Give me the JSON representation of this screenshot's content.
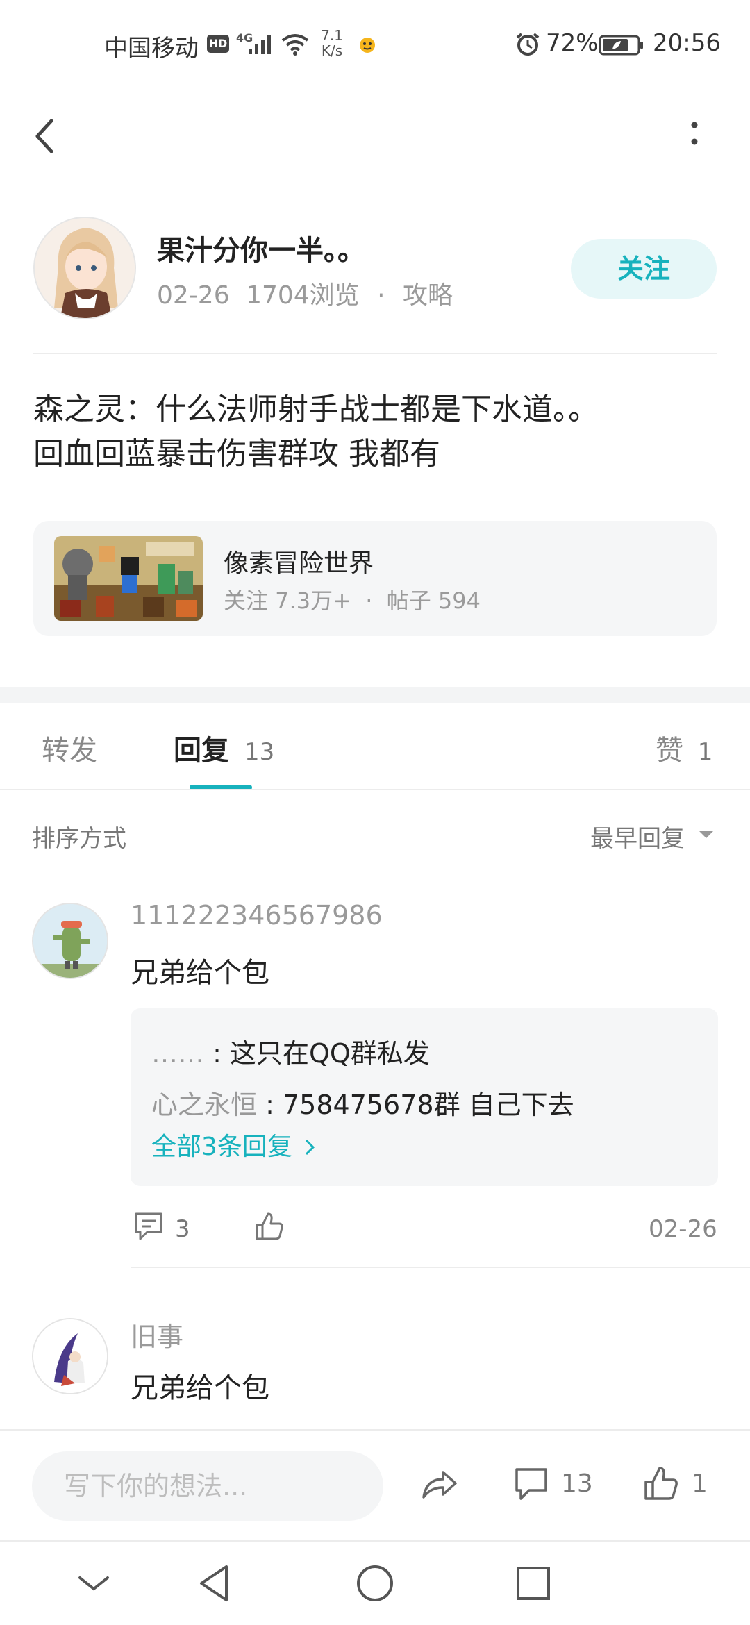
{
  "status_bar": {
    "carrier": "中国移动",
    "hd": "HD",
    "network": "4G",
    "speed_value": "7.1",
    "speed_unit": "K/s",
    "battery": "72%",
    "time": "20:56"
  },
  "post": {
    "author": "果汁分你一半。。",
    "date": "02-26",
    "views": "1704浏览",
    "separator": "·",
    "category": "攻略",
    "follow_label": "关注",
    "body_line1": "森之灵：什么法师射手战士都是下水道。。",
    "body_line2": "回血回蓝暴击伤害群攻 我都有"
  },
  "forum": {
    "name": "像素冒险世界",
    "stats": "关注 7.3万+  ·  帖子 594"
  },
  "tabs": {
    "repost": "转发",
    "reply": "回复",
    "reply_count": "13",
    "like": "赞",
    "like_count": "1"
  },
  "sort": {
    "label": "排序方式",
    "value": "最早回复"
  },
  "comments": [
    {
      "user": "111222346567986",
      "text": "兄弟给个包",
      "replies": [
        {
          "name": "……",
          "text": "这只在QQ群私发"
        },
        {
          "name": "心之永恒",
          "text": "758475678群 自己下去"
        }
      ],
      "all_replies": "全部3条回复",
      "reply_count": "3",
      "date": "02-26"
    },
    {
      "user": "旧事",
      "text": "兄弟给个包"
    }
  ],
  "bottom_bar": {
    "placeholder": "写下你的想法...",
    "comment_count": "13",
    "like_count": "1"
  },
  "colors": {
    "accent": "#17b2bd",
    "follow_bg": "#e6f7f8",
    "card_bg": "#f5f6f7"
  }
}
